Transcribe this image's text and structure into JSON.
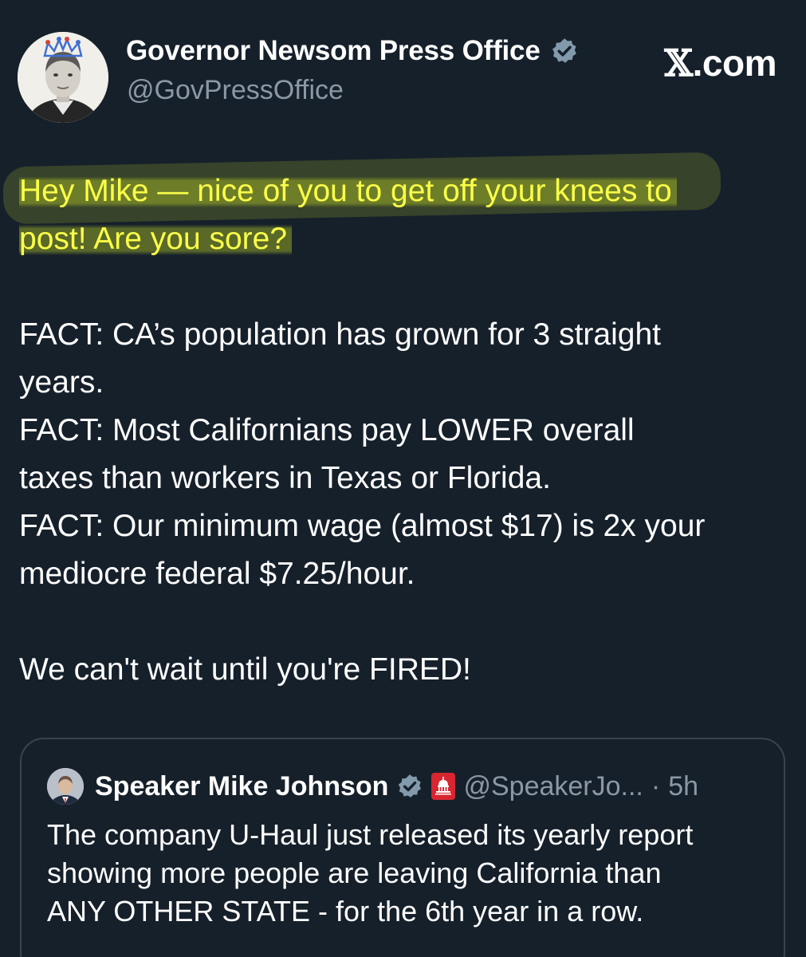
{
  "site_mark": {
    "x_glyph": "𝕏",
    "suffix": ".com"
  },
  "author": {
    "display_name": "Governor Newsom Press Office",
    "handle": "@GovPressOffice",
    "avatar_icon": "portrait-with-crown-icon",
    "verified_icon": "verified-badge-icon",
    "verified_color": "#829aab"
  },
  "tweet": {
    "highlight_color": "#fbff49",
    "highlighted_lines": [
      "Hey Mike — nice of you to get off your knees to",
      "post! Are you sore?"
    ],
    "fact_lines": [
      "FACT: CA’s population has grown for 3 straight",
      "years.",
      "FACT: Most Californians pay LOWER overall",
      "taxes than workers in Texas or Florida.",
      "FACT: Our minimum wage (almost $17) is 2x your",
      "mediocre federal $7.25/hour."
    ],
    "closing_line": "We can't wait until you're FIRED!"
  },
  "quoted_tweet": {
    "display_name": "Speaker Mike Johnson",
    "handle": "@SpeakerJo...",
    "separator": "·",
    "time": "5h",
    "verified_icon": "verified-badge-icon",
    "affiliate_icon": "capitol-building-icon",
    "affiliate_color": "#d7262f",
    "text_lines": [
      "The company U-Haul just released its yearly report",
      "showing more people are leaving California than",
      "ANY OTHER STATE - for the 6th year in a row."
    ]
  },
  "colors": {
    "background": "#16202b",
    "text": "#ffffff",
    "muted": "#8b98a5",
    "border": "#38444d"
  }
}
